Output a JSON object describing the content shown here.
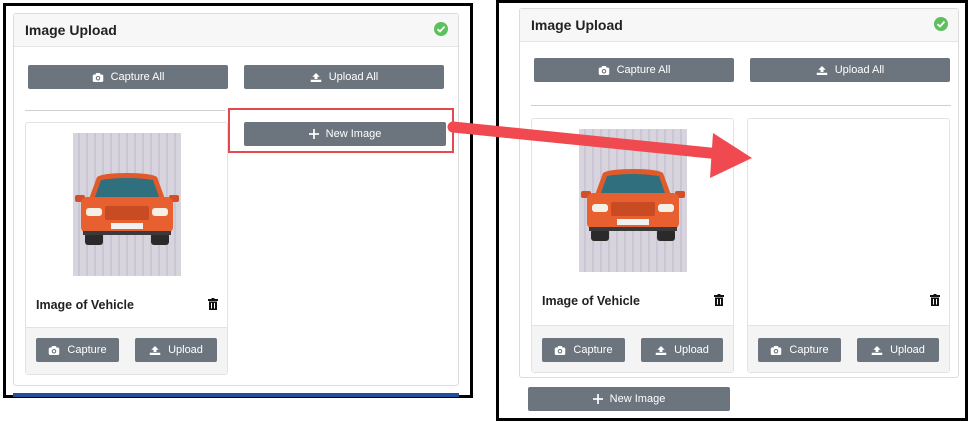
{
  "left_panel": {
    "title": "Image Upload",
    "capture_all": "Capture All",
    "upload_all": "Upload All",
    "new_image": "New Image",
    "card": {
      "label": "Image of Vehicle",
      "capture": "Capture",
      "upload": "Upload"
    }
  },
  "right_panel": {
    "title": "Image Upload",
    "capture_all": "Capture All",
    "upload_all": "Upload All",
    "new_image": "New Image",
    "card1": {
      "label": "Image of Vehicle",
      "capture": "Capture",
      "upload": "Upload"
    },
    "card2": {
      "capture": "Capture",
      "upload": "Upload"
    }
  },
  "colors": {
    "button": "#6c757d",
    "highlight": "#e5484d",
    "arrow": "#f04a50",
    "check": "#5cc05c"
  }
}
